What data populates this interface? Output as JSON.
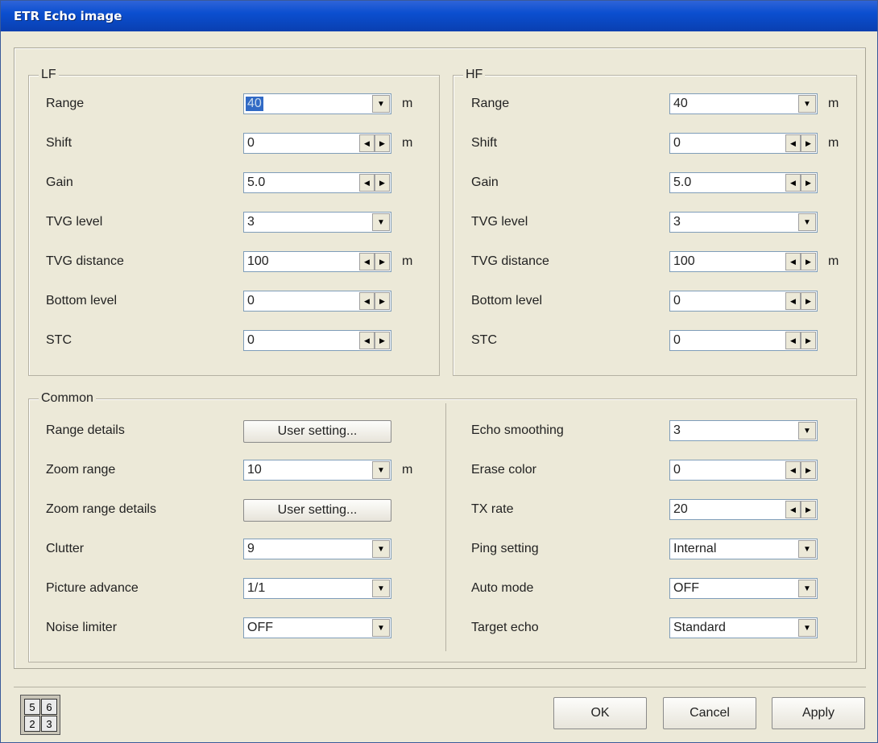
{
  "window": {
    "title": "ETR Echo image"
  },
  "lf": {
    "legend": "LF",
    "rows": [
      {
        "label": "Range",
        "value": "40",
        "unit": "m",
        "control": "dropdown"
      },
      {
        "label": "Shift",
        "value": "0",
        "unit": "m",
        "control": "spinner"
      },
      {
        "label": "Gain",
        "value": "5.0",
        "unit": "",
        "control": "spinner"
      },
      {
        "label": "TVG level",
        "value": "3",
        "unit": "",
        "control": "dropdown"
      },
      {
        "label": "TVG distance",
        "value": "100",
        "unit": "m",
        "control": "spinner"
      },
      {
        "label": "Bottom level",
        "value": "0",
        "unit": "",
        "control": "spinner"
      },
      {
        "label": "STC",
        "value": "0",
        "unit": "",
        "control": "spinner"
      }
    ]
  },
  "hf": {
    "legend": "HF",
    "rows": [
      {
        "label": "Range",
        "value": "40",
        "unit": "m",
        "control": "dropdown"
      },
      {
        "label": "Shift",
        "value": "0",
        "unit": "m",
        "control": "spinner"
      },
      {
        "label": "Gain",
        "value": "5.0",
        "unit": "",
        "control": "spinner"
      },
      {
        "label": "TVG level",
        "value": "3",
        "unit": "",
        "control": "dropdown"
      },
      {
        "label": "TVG distance",
        "value": "100",
        "unit": "m",
        "control": "spinner"
      },
      {
        "label": "Bottom level",
        "value": "0",
        "unit": "",
        "control": "spinner"
      },
      {
        "label": "STC",
        "value": "0",
        "unit": "",
        "control": "spinner"
      }
    ]
  },
  "common": {
    "legend": "Common",
    "left": [
      {
        "label": "Range details",
        "value": "User setting...",
        "unit": "",
        "control": "button"
      },
      {
        "label": "Zoom range",
        "value": "10",
        "unit": "m",
        "control": "dropdown"
      },
      {
        "label": "Zoom range details",
        "value": "User setting...",
        "unit": "",
        "control": "button"
      },
      {
        "label": "Clutter",
        "value": "9",
        "unit": "",
        "control": "dropdown"
      },
      {
        "label": "Picture advance",
        "value": "1/1",
        "unit": "",
        "control": "dropdown"
      },
      {
        "label": "Noise limiter",
        "value": "OFF",
        "unit": "",
        "control": "dropdown"
      }
    ],
    "right": [
      {
        "label": "Echo smoothing",
        "value": "3",
        "unit": "",
        "control": "dropdown"
      },
      {
        "label": "Erase color",
        "value": "0",
        "unit": "",
        "control": "spinner"
      },
      {
        "label": "TX rate",
        "value": "20",
        "unit": "",
        "control": "spinner"
      },
      {
        "label": "Ping setting",
        "value": "Internal",
        "unit": "",
        "control": "dropdown"
      },
      {
        "label": "Auto mode",
        "value": "OFF",
        "unit": "",
        "control": "dropdown"
      },
      {
        "label": "Target echo",
        "value": "Standard",
        "unit": "",
        "control": "dropdown"
      }
    ]
  },
  "footer": {
    "ok": "OK",
    "cancel": "Cancel",
    "apply": "Apply",
    "grid_icon": [
      "5",
      "6",
      "2",
      "3"
    ]
  },
  "icons": {
    "dropdown": "chevron-down-icon",
    "spin_left": "arrow-left-icon",
    "spin_right": "arrow-right-icon"
  }
}
